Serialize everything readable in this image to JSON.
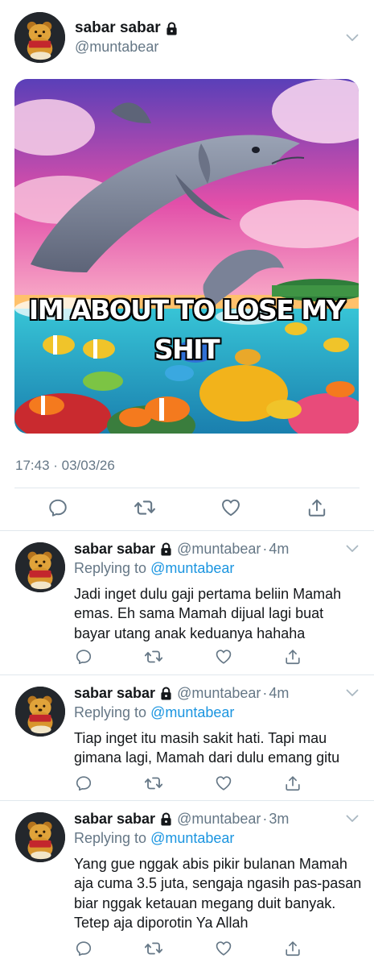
{
  "main_tweet": {
    "display_name": "sabar sabar",
    "handle": "@muntabear",
    "media": {
      "caption_line1": "IM ABOUT TO LOSE MY",
      "caption_line2": "SHIT"
    },
    "timestamp": "17:43 · 03/03/26",
    "actions": [
      "reply-icon",
      "retweet-icon",
      "like-icon",
      "share-icon"
    ]
  },
  "replies": [
    {
      "display_name": "sabar sabar",
      "handle": "@muntabear",
      "separator": "·",
      "time": "4m",
      "replying_prefix": "Replying to",
      "replying_to": "@muntabear",
      "text": "Jadi inget dulu gaji pertama beliin Mamah emas. Eh sama Mamah dijual lagi buat bayar utang anak keduanya hahaha"
    },
    {
      "display_name": "sabar sabar",
      "handle": "@muntabear",
      "separator": "·",
      "time": "4m",
      "replying_prefix": "Replying to",
      "replying_to": "@muntabear",
      "text": "Tiap inget itu masih sakit hati. Tapi mau gimana lagi, Mamah dari dulu emang gitu"
    },
    {
      "display_name": "sabar sabar",
      "handle": "@muntabear",
      "separator": "·",
      "time": "3m",
      "replying_prefix": "Replying to",
      "replying_to": "@muntabear",
      "text": "Yang gue nggak abis pikir bulanan Mamah aja cuma 3.5 juta, sengaja ngasih pas-pasan biar nggak ketauan megang duit banyak. Tetep aja diporotin Ya Allah"
    }
  ],
  "colors": {
    "text": "#14171a",
    "secondary": "#657786",
    "link": "#1b95e0",
    "divider": "#e1e8ed"
  }
}
